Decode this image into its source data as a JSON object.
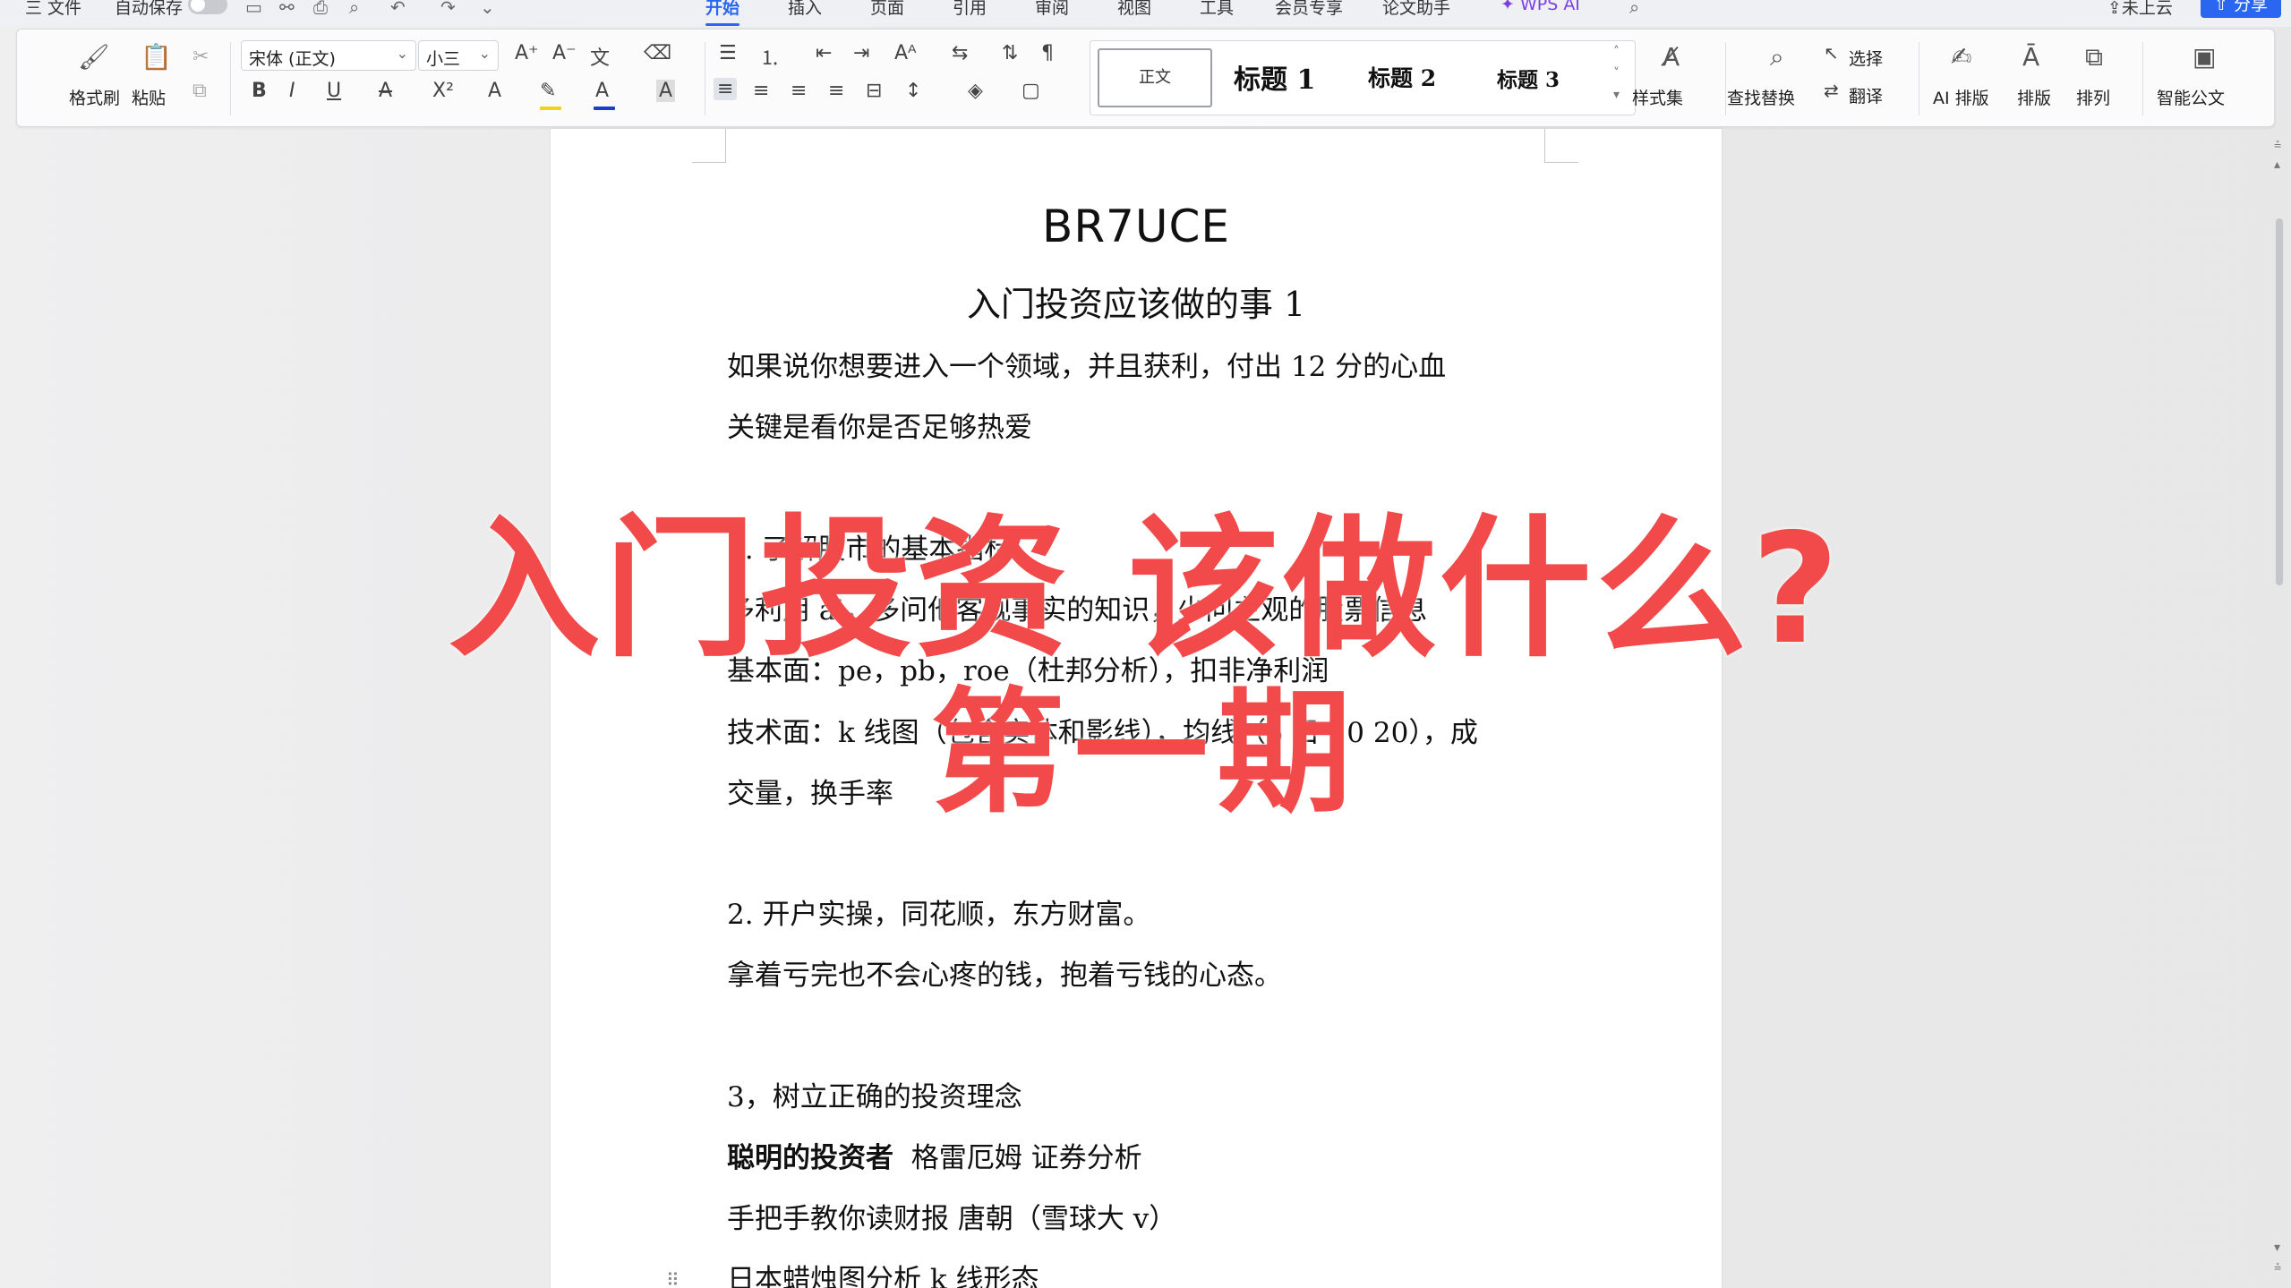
{
  "menubar": {
    "file": "三 文件",
    "autosave": "自动保存",
    "tabs": [
      "开始",
      "插入",
      "页面",
      "引用",
      "审阅",
      "视图",
      "工具",
      "会员专享",
      "论文助手",
      "WPS AI"
    ],
    "cloud": "未上云",
    "share": "分享"
  },
  "ribbon": {
    "format_painter": "格式刷",
    "paste": "粘贴",
    "font_name": "宋体 (正文)",
    "font_size": "小三",
    "styles": {
      "normal": "正文",
      "h1": "标题 1",
      "h2": "标题 2",
      "h3": "标题 3"
    },
    "style_set": "样式集",
    "find_replace": "查找替换",
    "select": "选择",
    "translate": "翻译",
    "ai_layout": "AI 排版",
    "layout": "排版",
    "arrange": "排列",
    "smart_doc": "智能公文",
    "colors": {
      "highlight": "#f2d31b",
      "font_color": "#1a3fc9"
    }
  },
  "document": {
    "title": "BR7UCE",
    "subtitle": "入门投资应该做的事 1",
    "lines": [
      "如果说你想要进入一个领域，并且获利，付出 12 分的心血",
      "关键是看你是否足够热爱",
      "1. 了解股市的基本指标",
      "多利用 ai，多问他客观事实的知识，少问主观的股票信息",
      "基本面：pe，pb，roe（杜邦分析），扣非净利润",
      "技术面：k 线图（包含实体和影线），均线（5 日 10 20），成",
      "交量，换手率",
      "2. 开户实操，同花顺，东方财富。",
      "拿着亏完也不会心疼的钱，抱着亏钱的心态。",
      "3，树立正确的投资理念",
      "格雷厄姆  证券分析",
      "手把手教你读财报  唐朝（雪球大 v）",
      "日本蜡烛图分析  k 线形态"
    ],
    "bold_prefix": "聪明的投资者"
  },
  "overlay": {
    "line1": "入门投资 该做什么?",
    "line2": "第一期",
    "color": "#f24a4a"
  }
}
